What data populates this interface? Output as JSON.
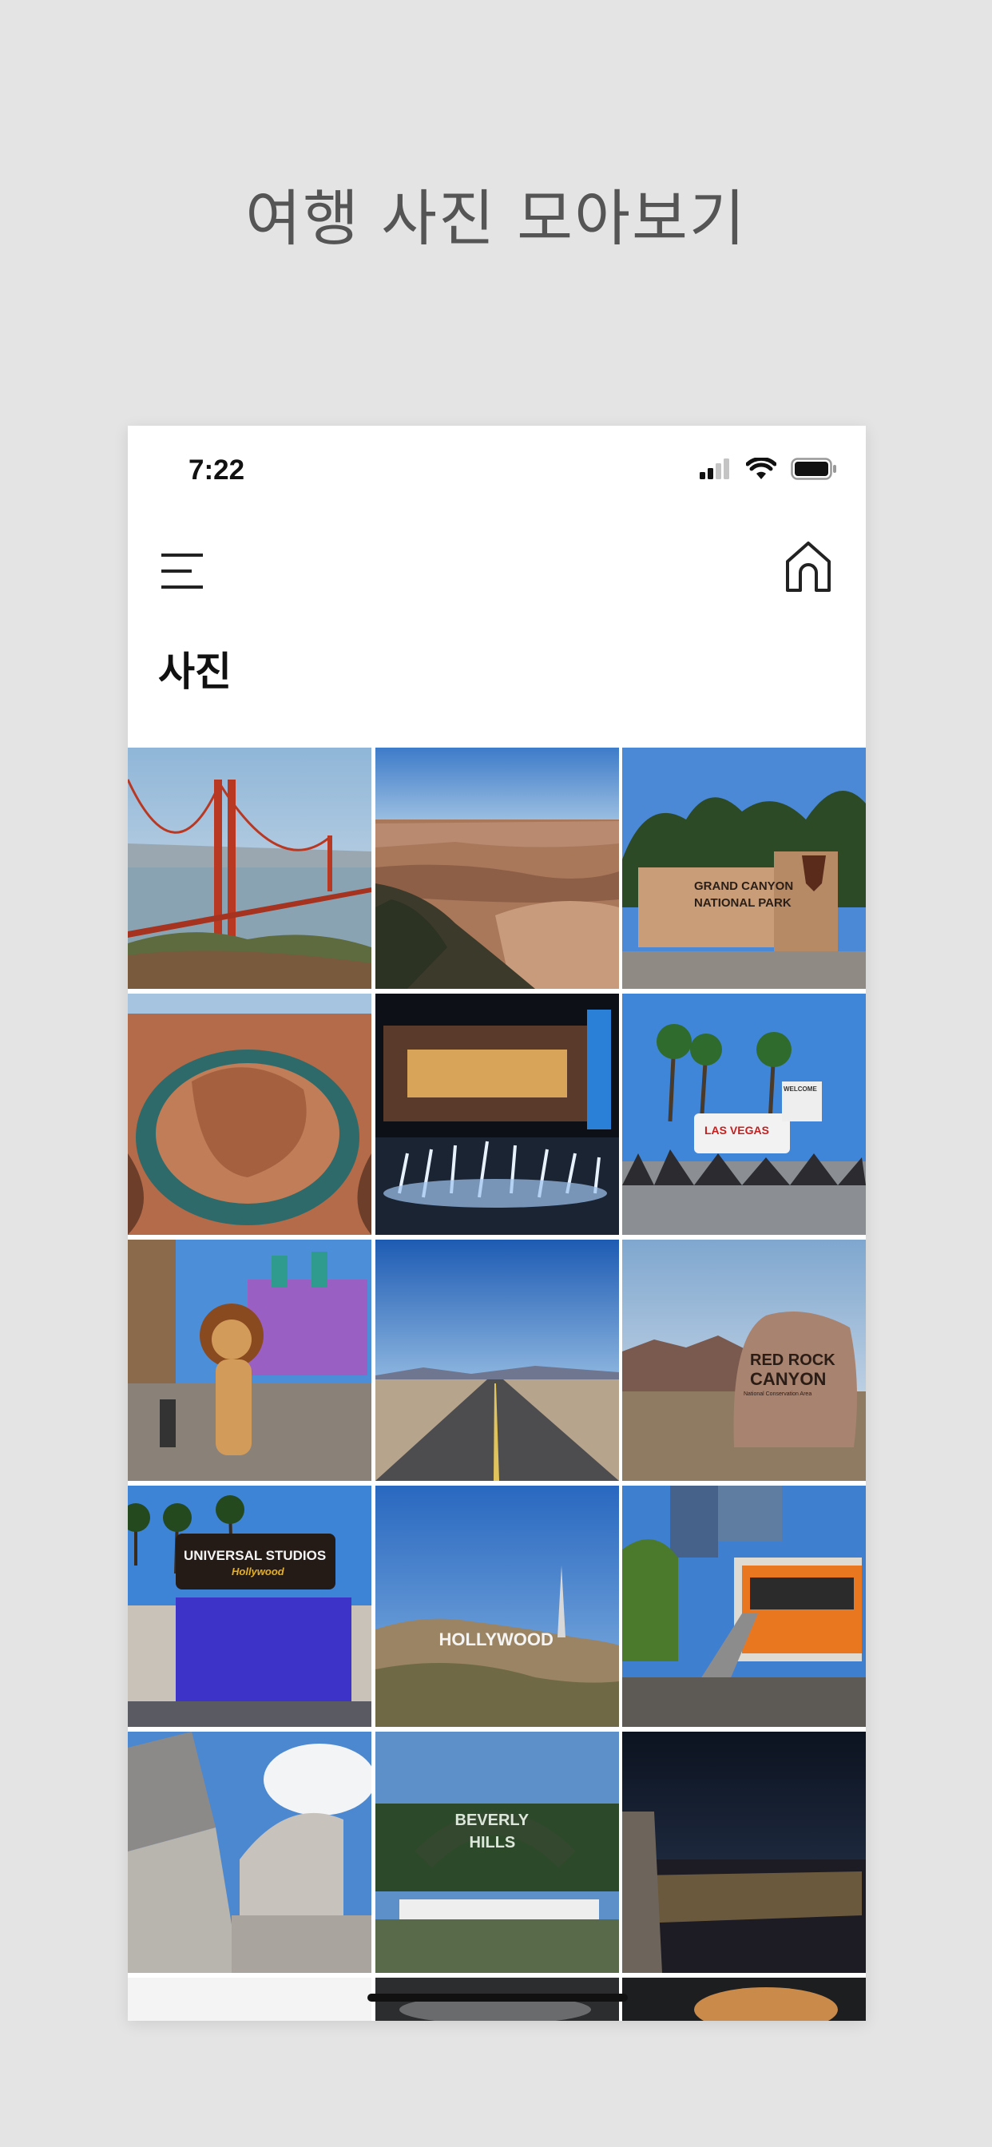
{
  "promo": {
    "title": "여행 사진 모아보기"
  },
  "status_bar": {
    "time": "7:22"
  },
  "header": {
    "title": "사진"
  },
  "icons": {
    "menu": "hamburger-menu-icon",
    "home": "home-icon",
    "signal": "cellular-signal-icon",
    "wifi": "wifi-icon",
    "battery": "battery-icon"
  },
  "photos": [
    {
      "subject": "golden-gate-bridge"
    },
    {
      "subject": "grand-canyon"
    },
    {
      "subject": "grand-canyon-sign",
      "caption_1": "GRAND CANYON",
      "caption_2": "NATIONAL PARK"
    },
    {
      "subject": "horseshoe-bend"
    },
    {
      "subject": "las-vegas-fountain"
    },
    {
      "subject": "las-vegas-sign",
      "caption_1": "LAS VEGAS",
      "caption_2": "WELCOME"
    },
    {
      "subject": "lion-mascot-park"
    },
    {
      "subject": "desert-road"
    },
    {
      "subject": "red-rock-canyon",
      "caption_1": "RED ROCK",
      "caption_2": "CANYON",
      "caption_3": "National Conservation Area"
    },
    {
      "subject": "universal-studios",
      "caption_1": "UNIVERSAL STUDIOS",
      "caption_2": "Hollywood"
    },
    {
      "subject": "hollywood-sign",
      "caption_1": "HOLLYWOOD"
    },
    {
      "subject": "angels-flight"
    },
    {
      "subject": "disney-concert-hall"
    },
    {
      "subject": "beverly-hills-sign",
      "caption_1": "BEVERLY",
      "caption_2": "HILLS"
    },
    {
      "subject": "la-night-view"
    },
    {
      "subject": "partial-photo-1"
    },
    {
      "subject": "partial-photo-2"
    },
    {
      "subject": "partial-photo-3"
    }
  ]
}
